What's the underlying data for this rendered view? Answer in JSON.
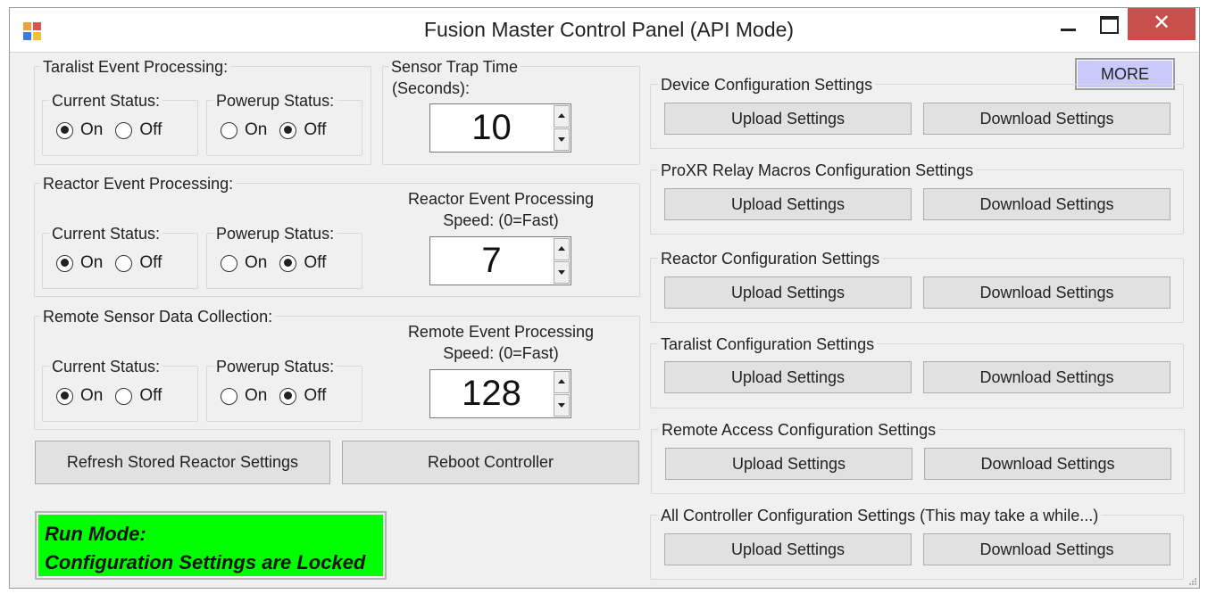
{
  "window": {
    "title": "Fusion Master Control Panel (API Mode)",
    "close_glyph": "✕"
  },
  "taralist": {
    "legend": "Taralist Event Processing:",
    "current_status": {
      "label": "Current Status:",
      "on": "On",
      "off": "Off",
      "selected": "On"
    },
    "powerup_status": {
      "label": "Powerup Status:",
      "on": "On",
      "off": "Off",
      "selected": "Off"
    }
  },
  "sensor_trap": {
    "label_line1": "Sensor Trap Time",
    "label_line2": "(Seconds):",
    "value": "10"
  },
  "reactor": {
    "legend": "Reactor Event Processing:",
    "current_status": {
      "label": "Current Status:",
      "on": "On",
      "off": "Off",
      "selected": "On"
    },
    "powerup_status": {
      "label": "Powerup Status:",
      "on": "On",
      "off": "Off",
      "selected": "Off"
    },
    "speed_label_line1": "Reactor Event Processing",
    "speed_label_line2": "Speed:  (0=Fast)",
    "speed_value": "7"
  },
  "remote": {
    "legend": "Remote Sensor Data Collection:",
    "current_status": {
      "label": "Current Status:",
      "on": "On",
      "off": "Off",
      "selected": "On"
    },
    "powerup_status": {
      "label": "Powerup Status:",
      "on": "On",
      "off": "Off",
      "selected": "Off"
    },
    "speed_label_line1": "Remote Event Processing",
    "speed_label_line2": "Speed:  (0=Fast)",
    "speed_value": "128"
  },
  "actions": {
    "refresh_label": "Refresh Stored Reactor Settings",
    "reboot_label": "Reboot Controller"
  },
  "run_mode": {
    "line1": "Run Mode:",
    "line2": "Configuration Settings are Locked",
    "color": "#00ff00"
  },
  "more_label": "MORE",
  "config_sections": [
    {
      "title": "Device Configuration Settings",
      "upload": "Upload Settings",
      "download": "Download Settings"
    },
    {
      "title": "ProXR Relay Macros Configuration Settings",
      "upload": "Upload Settings",
      "download": "Download Settings"
    },
    {
      "title": "Reactor Configuration Settings",
      "upload": "Upload Settings",
      "download": "Download Settings"
    },
    {
      "title": "Taralist Configuration Settings",
      "upload": "Upload Settings",
      "download": "Download Settings"
    },
    {
      "title": "Remote Access Configuration Settings",
      "upload": "Upload Settings",
      "download": "Download Settings"
    },
    {
      "title": "All Controller Configuration Settings (This may take a while...)",
      "upload": "Upload Settings",
      "download": "Download Settings"
    }
  ],
  "colors": {
    "close_button": "#c7504d",
    "more_button": "#c9c9fb",
    "window_bg": "#f0f0f0"
  }
}
